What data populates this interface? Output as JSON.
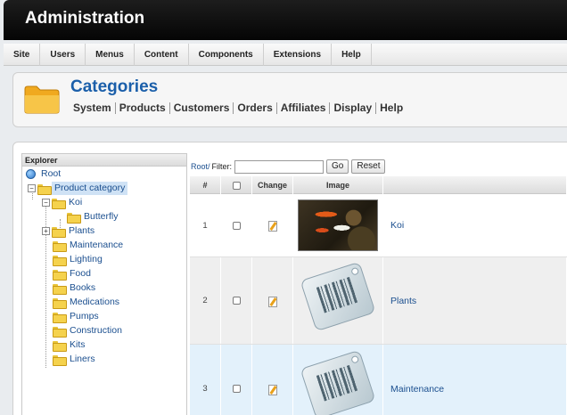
{
  "header": {
    "title": "Administration"
  },
  "menu": [
    "Site",
    "Users",
    "Menus",
    "Content",
    "Components",
    "Extensions",
    "Help"
  ],
  "page": {
    "title": "Categories",
    "subnav": [
      "System",
      "Products",
      "Customers",
      "Orders",
      "Affiliates",
      "Display",
      "Help"
    ]
  },
  "explorer": {
    "title": "Explorer",
    "root": "Root",
    "nodes": [
      "Product category",
      "Koi",
      "Butterfly",
      "Plants",
      "Maintenance",
      "Lighting",
      "Food",
      "Books",
      "Medications",
      "Pumps",
      "Construction",
      "Kits",
      "Liners"
    ],
    "selected": "Product category"
  },
  "toolbar": {
    "root_link": "Root/",
    "filter_label": "Filter:",
    "filter_value": "",
    "go_label": "Go",
    "reset_label": "Reset"
  },
  "grid": {
    "columns": [
      "#",
      "",
      "Change",
      "Image",
      ""
    ],
    "rows": [
      {
        "num": "1",
        "name": "Koi",
        "image": "koi-photo"
      },
      {
        "num": "2",
        "name": "Plants",
        "image": "barcode-placeholder"
      },
      {
        "num": "3",
        "name": "Maintenance",
        "image": "barcode-placeholder"
      }
    ]
  },
  "colors": {
    "accent": "#1b5faa",
    "link": "#1b4f8f",
    "header_bg": "#111111",
    "row_highlight": "#e3f1fb",
    "row_alt": "#efefef"
  }
}
